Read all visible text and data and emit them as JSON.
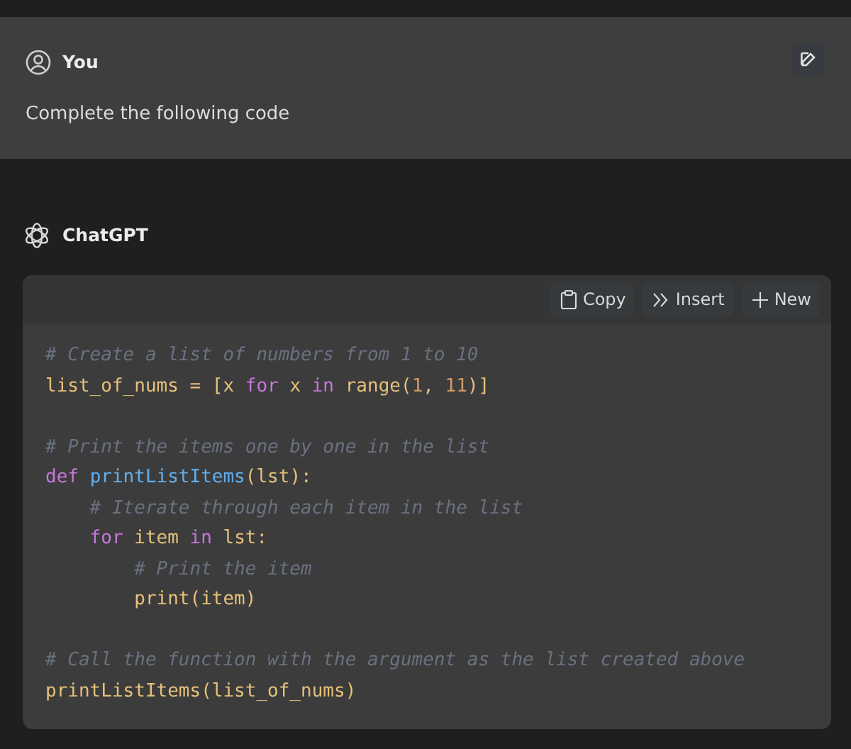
{
  "user_message": {
    "author": "You",
    "text": "Complete the following code"
  },
  "assistant_message": {
    "author": "ChatGPT",
    "code_block": {
      "actions": [
        {
          "kind": "copy",
          "label": "Copy"
        },
        {
          "kind": "insert",
          "label": "Insert"
        },
        {
          "kind": "new",
          "label": "New"
        }
      ],
      "lines": [
        {
          "kind": "code",
          "tokens": [
            {
              "kind": "comment",
              "text": "# Create a list of numbers from 1 to 10"
            }
          ]
        },
        {
          "kind": "code",
          "tokens": [
            {
              "kind": "plain",
              "text": "list_of_nums = [x "
            },
            {
              "kind": "keyword",
              "text": "for"
            },
            {
              "kind": "plain",
              "text": " x "
            },
            {
              "kind": "keyword",
              "text": "in"
            },
            {
              "kind": "plain",
              "text": " range("
            },
            {
              "kind": "number",
              "text": "1"
            },
            {
              "kind": "plain",
              "text": ", "
            },
            {
              "kind": "number",
              "text": "11"
            },
            {
              "kind": "plain",
              "text": ")]"
            }
          ]
        },
        {
          "kind": "blank"
        },
        {
          "kind": "code",
          "tokens": [
            {
              "kind": "comment",
              "text": "# Print the items one by one in the list"
            }
          ]
        },
        {
          "kind": "code",
          "tokens": [
            {
              "kind": "keyword",
              "text": "def "
            },
            {
              "kind": "function",
              "text": "printListItems"
            },
            {
              "kind": "plain",
              "text": "(lst):"
            }
          ]
        },
        {
          "kind": "code",
          "tokens": [
            {
              "kind": "comment",
              "text": "    # Iterate through each item in the list"
            }
          ]
        },
        {
          "kind": "code",
          "tokens": [
            {
              "kind": "keyword",
              "text": "    for"
            },
            {
              "kind": "plain",
              "text": " item "
            },
            {
              "kind": "keyword",
              "text": "in"
            },
            {
              "kind": "plain",
              "text": " lst:"
            }
          ]
        },
        {
          "kind": "code",
          "tokens": [
            {
              "kind": "comment",
              "text": "        # Print the item"
            }
          ]
        },
        {
          "kind": "code",
          "tokens": [
            {
              "kind": "plain",
              "text": "        print(item)"
            }
          ]
        },
        {
          "kind": "blank"
        },
        {
          "kind": "code",
          "tokens": [
            {
              "kind": "comment",
              "text": "# Call the function with the argument as the list created above"
            }
          ]
        },
        {
          "kind": "code",
          "tokens": [
            {
              "kind": "plain",
              "text": "printListItems(list_of_nums)"
            }
          ]
        }
      ]
    }
  }
}
